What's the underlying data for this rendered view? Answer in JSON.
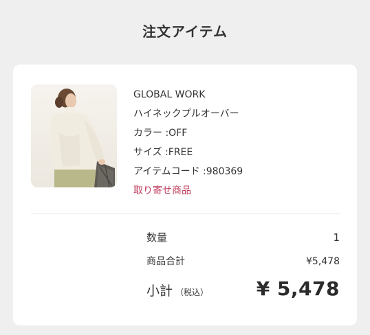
{
  "page": {
    "title": "注文アイテム"
  },
  "item": {
    "brand": "GLOBAL WORK",
    "name": "ハイネックプルオーバー",
    "color": "カラー :OFF",
    "size": "サイズ :FREE",
    "code": "アイテムコード :980369",
    "notice": "取り寄せ商品",
    "image_icon": "product-photo"
  },
  "summary": {
    "quantity_label": "数量",
    "quantity_value": "1",
    "subtotal_label": "商品合計",
    "subtotal_value": "¥5,478",
    "total_label": "小計",
    "total_tax_note": "（税込）",
    "total_value": "¥ 5,478"
  },
  "colors": {
    "background": "#efefef",
    "card": "#ffffff",
    "text": "#333333",
    "notice": "#c0405f"
  }
}
